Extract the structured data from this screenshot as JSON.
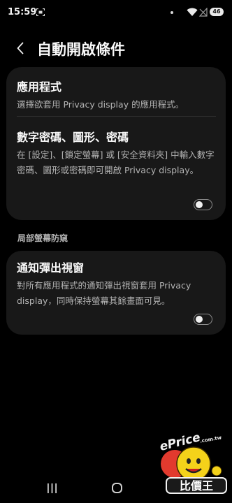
{
  "status_bar": {
    "time": "15:59",
    "battery": "46",
    "icons": [
      "screenshot-icon",
      "dot-icon",
      "wifi-icon",
      "no-signal-icon",
      "battery-icon"
    ]
  },
  "header": {
    "title": "自動開啟條件",
    "back_icon": "back-icon"
  },
  "card1": {
    "apps": {
      "title": "應用程式",
      "desc": "選擇欲套用 Privacy display 的應用程式。"
    },
    "pin": {
      "title": "數字密碼、圖形、密碼",
      "desc": "在 [設定]、[鎖定螢幕] 或 [安全資料夾] 中輸入數字密碼、圖形或密碼即可開啟 Privacy display。",
      "toggle_on": false
    }
  },
  "section": {
    "title": "局部螢幕防窺"
  },
  "card2": {
    "notification": {
      "title": "通知彈出視窗",
      "desc": "對所有應用程式的通知彈出視窗套用 Privacy display，同時保持螢幕其餘畫面可見。",
      "toggle_on": false
    }
  },
  "nav_bar": {
    "icons": [
      "recent-apps-icon",
      "home-icon",
      "back-icon"
    ]
  },
  "watermark": {
    "brand": "ePrice",
    "domain": ".com.tw",
    "name": "比價王"
  },
  "colors": {
    "background": "#000000",
    "card": "#181818",
    "text_primary": "#fafafa",
    "text_secondary": "#b3b3b3",
    "toggle_border": "#8e8e8e"
  }
}
